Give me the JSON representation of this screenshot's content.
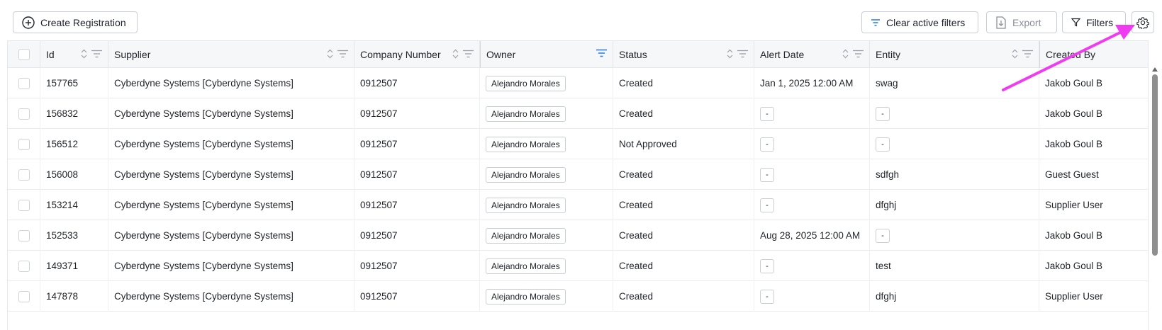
{
  "toolbar": {
    "create_label": "Create Registration",
    "clear_label": "Clear active filters",
    "export_label": "Export",
    "filters_label": "Filters"
  },
  "columns": [
    {
      "key": "id",
      "label": "Id"
    },
    {
      "key": "supplier",
      "label": "Supplier"
    },
    {
      "key": "company_number",
      "label": "Company Number"
    },
    {
      "key": "owner",
      "label": "Owner"
    },
    {
      "key": "status",
      "label": "Status"
    },
    {
      "key": "alert_date",
      "label": "Alert Date"
    },
    {
      "key": "entity",
      "label": "Entity"
    },
    {
      "key": "created_by",
      "label": "Created By"
    }
  ],
  "rows": [
    {
      "id": "157765",
      "supplier": "Cyberdyne Systems [Cyberdyne Systems]",
      "company_number": "0912507",
      "owner": "Alejandro Morales",
      "status": "Created",
      "alert_date": "Jan 1, 2025 12:00 AM",
      "entity": "swag",
      "created_by": "Jakob Goul B"
    },
    {
      "id": "156832",
      "supplier": "Cyberdyne Systems [Cyberdyne Systems]",
      "company_number": "0912507",
      "owner": "Alejandro Morales",
      "status": "Created",
      "alert_date": "-",
      "entity": "-",
      "created_by": "Jakob Goul B"
    },
    {
      "id": "156512",
      "supplier": "Cyberdyne Systems [Cyberdyne Systems]",
      "company_number": "0912507",
      "owner": "Alejandro Morales",
      "status": "Not Approved",
      "alert_date": "-",
      "entity": "-",
      "created_by": "Jakob Goul B"
    },
    {
      "id": "156008",
      "supplier": "Cyberdyne Systems [Cyberdyne Systems]",
      "company_number": "0912507",
      "owner": "Alejandro Morales",
      "status": "Created",
      "alert_date": "-",
      "entity": "sdfgh",
      "created_by": "Guest Guest"
    },
    {
      "id": "153214",
      "supplier": "Cyberdyne Systems [Cyberdyne Systems]",
      "company_number": "0912507",
      "owner": "Alejandro Morales",
      "status": "Created",
      "alert_date": "-",
      "entity": "dfghj",
      "created_by": "Supplier User"
    },
    {
      "id": "152533",
      "supplier": "Cyberdyne Systems [Cyberdyne Systems]",
      "company_number": "0912507",
      "owner": "Alejandro Morales",
      "status": "Created",
      "alert_date": "Aug 28, 2025 12:00 AM",
      "entity": "-",
      "created_by": "Jakob Goul B"
    },
    {
      "id": "149371",
      "supplier": "Cyberdyne Systems [Cyberdyne Systems]",
      "company_number": "0912507",
      "owner": "Alejandro Morales",
      "status": "Created",
      "alert_date": "-",
      "entity": "test",
      "created_by": "Jakob Goul B"
    },
    {
      "id": "147878",
      "supplier": "Cyberdyne Systems [Cyberdyne Systems]",
      "company_number": "0912507",
      "owner": "Alejandro Morales",
      "status": "Created",
      "alert_date": "-",
      "entity": "dfghj",
      "created_by": "Supplier User"
    }
  ],
  "colors": {
    "accent_filter": "#2f80ed",
    "annotation_arrow": "#f03cf0"
  },
  "icons": {
    "create": "plus-circle-icon",
    "clear": "filter-lines-icon",
    "export": "file-download-icon",
    "filters": "funnel-icon",
    "settings": "gear-icon"
  }
}
